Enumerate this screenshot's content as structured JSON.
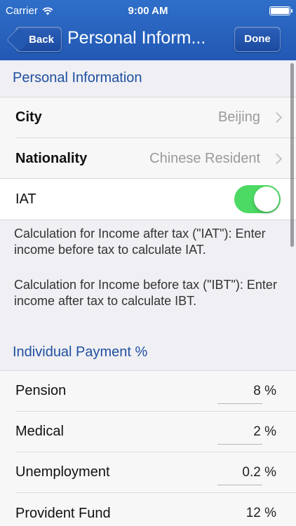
{
  "status_bar": {
    "carrier": "Carrier",
    "time": "9:00 AM"
  },
  "nav": {
    "back_label": "Back",
    "title": "Personal Inform...",
    "done_label": "Done"
  },
  "personal_info": {
    "header": "Personal Information",
    "rows": [
      {
        "label": "City",
        "value": "Beijing"
      },
      {
        "label": "Nationality",
        "value": "Chinese Resident"
      }
    ],
    "iat": {
      "label": "IAT",
      "toggle_on": true
    }
  },
  "descriptions": [
    "Calculation for Income after tax (\"IAT\"): Enter income before tax to calculate IAT.",
    "Calculation for Income before tax (\"IBT\"): Enter income after tax to calculate IBT."
  ],
  "payment": {
    "header": "Individual Payment %",
    "rows": [
      {
        "label": "Pension",
        "value": "8 %"
      },
      {
        "label": "Medical",
        "value": "2 %"
      },
      {
        "label": "Unemployment",
        "value": "0.2 %"
      },
      {
        "label": "Provident Fund",
        "value": "12 %"
      }
    ]
  },
  "colors": {
    "nav_blue": "#2463bd",
    "header_text": "#1f4f9f",
    "toggle_green": "#4cd964"
  }
}
